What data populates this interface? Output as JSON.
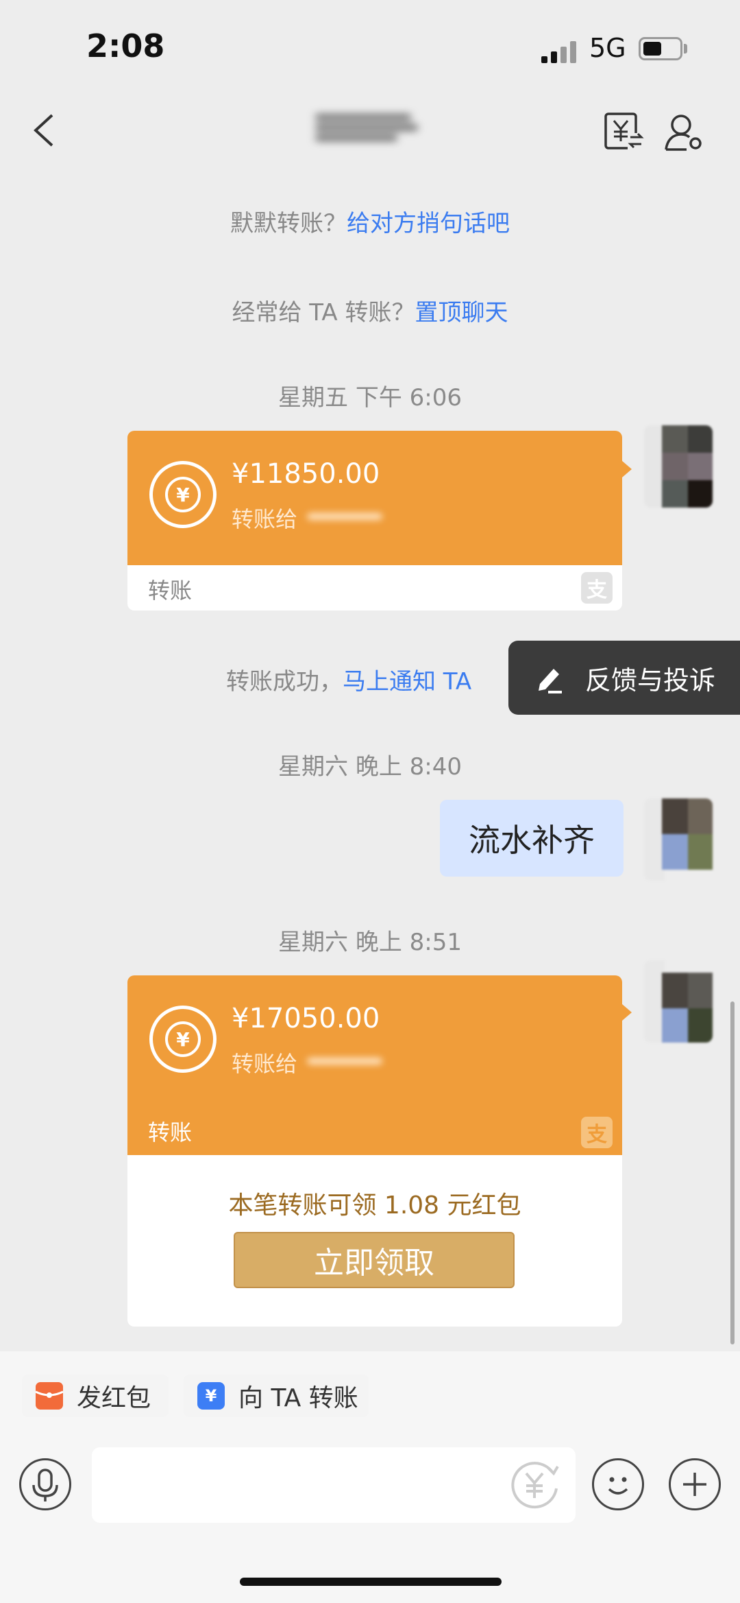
{
  "status_bar": {
    "time": "2:08",
    "network": "5G"
  },
  "nav": {
    "back_icon": "chevron-left-icon",
    "transfer_icon": "yuan-transfer-icon",
    "profile_icon": "user-settings-icon"
  },
  "system_messages": {
    "hint1_prefix": "默默转账？",
    "hint1_link": "给对方捎句话吧",
    "hint2_prefix": "经常给 TA 转账？",
    "hint2_link": "置顶聊天",
    "success_prefix": "转账成功，",
    "success_link": "马上通知 TA"
  },
  "timestamps": [
    "星期五 下午 6:06",
    "星期六 晚上 8:40",
    "星期六 晚上 8:51"
  ],
  "transfer1": {
    "amount": "¥11850.00",
    "to_label": "转账给",
    "footer": "转账"
  },
  "feedback": {
    "label": "反馈与投诉"
  },
  "text_message": "流水补齐",
  "transfer2": {
    "amount": "¥17050.00",
    "to_label": "转账给",
    "footer": "转账",
    "red_packet_text": "本笔转账可领 1.08 元红包",
    "claim_button": "立即领取"
  },
  "quick_actions": {
    "red_packet": "发红包",
    "transfer": "向 TA 转账"
  },
  "colors": {
    "accent": "#f09d3a",
    "link": "#3b7cf0",
    "bubble": "#d7e5ff",
    "gold": "#d8ad66"
  }
}
